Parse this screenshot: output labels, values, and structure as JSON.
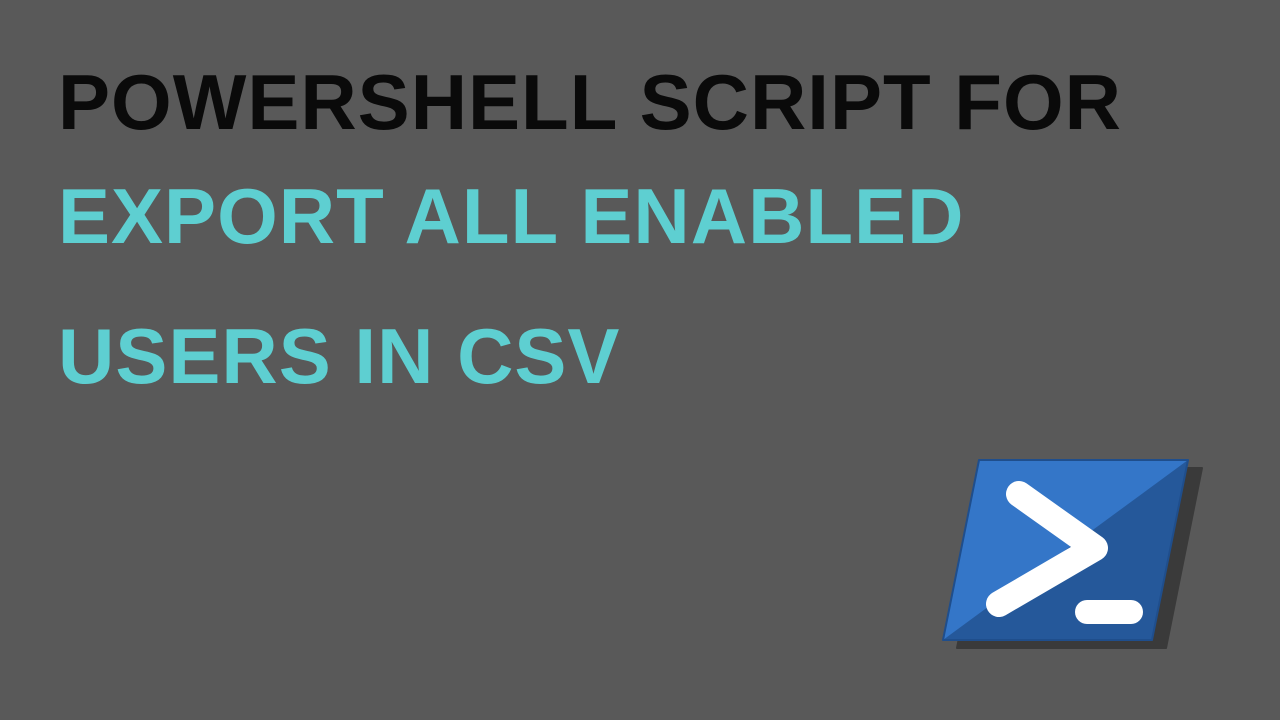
{
  "heading": {
    "line1": "POWERSHELL SCRIPT FOR",
    "line2": "EXPORT ALL ENABLED",
    "line3": "USERS IN CSV"
  },
  "logo": {
    "name": "powershell-icon",
    "fill_light": "#3476c8",
    "fill_dark": "#25589a",
    "glyph": "#ffffff"
  }
}
